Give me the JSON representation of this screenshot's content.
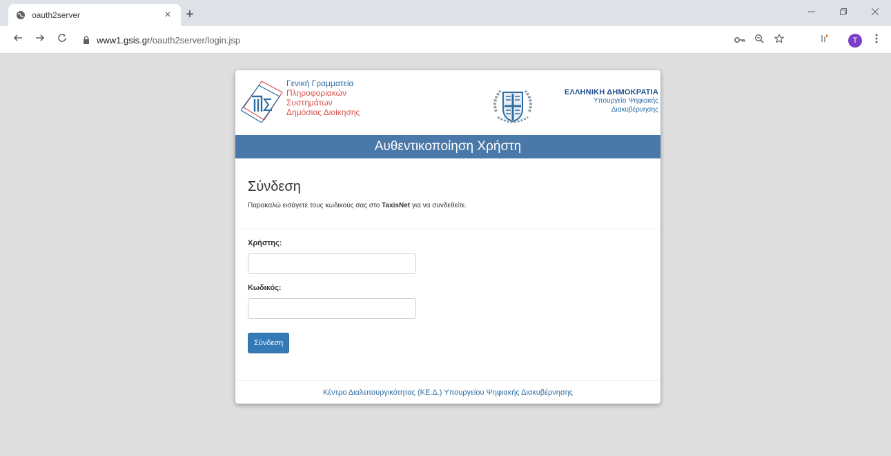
{
  "browser": {
    "tab_title": "oauth2server",
    "tab_close": "×",
    "new_tab": "+",
    "url_host": "www1.gsis.gr",
    "url_path": "/oauth2server/login.jsp",
    "profile_initial": "T"
  },
  "header": {
    "gsis_lines": [
      "Γενική Γραμματεία",
      "Πληροφοριακών",
      "Συστημάτων",
      "Δημόσιας Διοίκησης"
    ],
    "gr_title": "ΕΛΛΗΝΙΚΗ ΔΗΜΟΚΡΑΤΙΑ",
    "gr_sub1": "Υπουργείο Ψηφιακής",
    "gr_sub2": "Διακυβέρνησης"
  },
  "banner": "Αυθεντικοποίηση Χρήστη",
  "login": {
    "title": "Σύνδεση",
    "instr_before": "Παρακαλώ εισάγετε τους κωδικούς σας στο ",
    "instr_bold": "TaxisNet",
    "instr_after": " για να συνδεθείτε.",
    "user_label": "Χρήστης:",
    "user_value": "",
    "pass_label": "Κωδικός:",
    "pass_value": "",
    "submit_label": "Σύνδεση"
  },
  "footer": "Κέντρο Διαλειτουργικότητας (ΚΕ.Δ.) Υπουργείου Ψηφιακής Διακυβέρνησης",
  "colors": {
    "banner": "#4a78a8",
    "button": "#337ab7",
    "accent_red": "#d9534f",
    "accent_blue": "#2e6da4"
  }
}
